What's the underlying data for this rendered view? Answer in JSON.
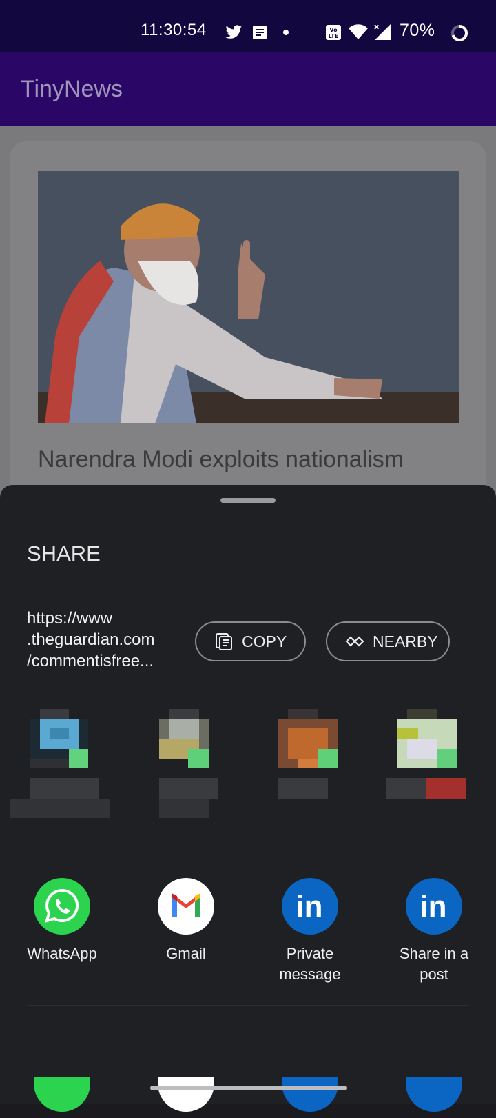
{
  "status_bar": {
    "time": "11:30:54",
    "battery": "70%",
    "icons": [
      "twitter-icon",
      "news-icon",
      "dot-icon",
      "volte-icon",
      "wifi-icon",
      "signal-icon",
      "battery-ring-icon"
    ]
  },
  "app_bar": {
    "title": "TinyNews"
  },
  "article": {
    "headline": "Narendra Modi exploits nationalism"
  },
  "share_sheet": {
    "title": "SHARE",
    "url_lines": [
      "https://www",
      ".theguardian.com",
      "/commentisfree..."
    ],
    "copy_label": "COPY",
    "nearby_label": "NEARBY",
    "apps": [
      {
        "name": "whatsapp",
        "label": "WhatsApp",
        "color": "#2bd34f"
      },
      {
        "name": "gmail",
        "label": "Gmail",
        "color": "#ffffff"
      },
      {
        "name": "linkedin-private",
        "label": "Private message",
        "color": "#0a66c2"
      },
      {
        "name": "linkedin-post",
        "label": "Share in a post",
        "color": "#0a66c2"
      }
    ]
  },
  "colors": {
    "status_bar_bg": "#12073f",
    "app_bar_bg": "#2a0766",
    "sheet_bg": "#1f2023"
  }
}
